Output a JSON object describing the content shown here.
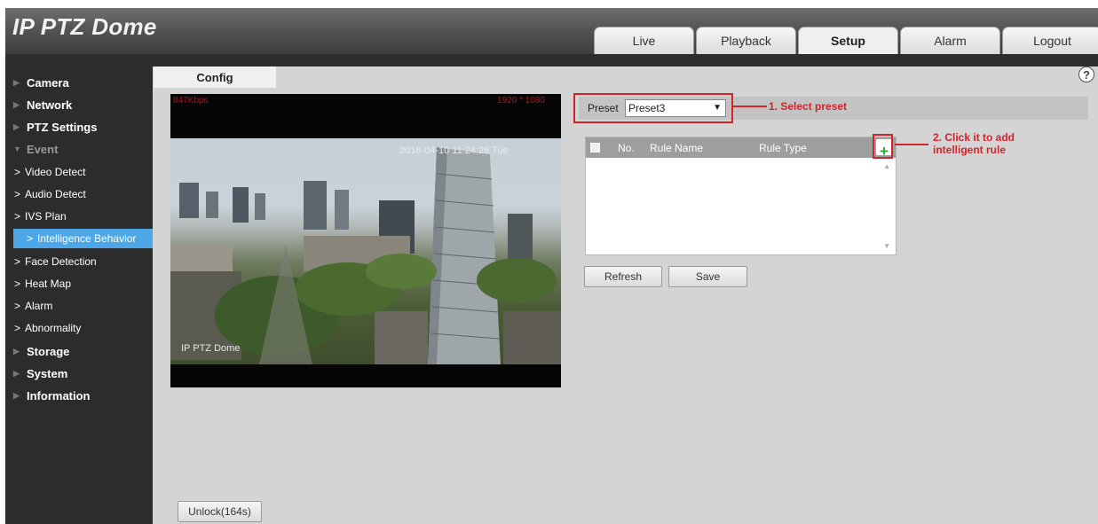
{
  "header": {
    "logo": "IP PTZ Dome",
    "tabs": [
      {
        "label": "Live",
        "active": false
      },
      {
        "label": "Playback",
        "active": false
      },
      {
        "label": "Setup",
        "active": true
      },
      {
        "label": "Alarm",
        "active": false
      },
      {
        "label": "Logout",
        "active": false
      }
    ]
  },
  "sidebar": {
    "items": [
      {
        "label": "Camera",
        "level": "top"
      },
      {
        "label": "Network",
        "level": "top"
      },
      {
        "label": "PTZ Settings",
        "level": "top"
      },
      {
        "label": "Event",
        "level": "top-expanded"
      },
      {
        "label": "Video Detect",
        "level": "sub"
      },
      {
        "label": "Audio Detect",
        "level": "sub"
      },
      {
        "label": "IVS Plan",
        "level": "sub"
      },
      {
        "label": "Intelligence Behavior",
        "level": "sub",
        "active": true
      },
      {
        "label": "Face Detection",
        "level": "sub"
      },
      {
        "label": "Heat Map",
        "level": "sub"
      },
      {
        "label": "Alarm",
        "level": "sub"
      },
      {
        "label": "Abnormality",
        "level": "sub"
      },
      {
        "label": "Storage",
        "level": "top"
      },
      {
        "label": "System",
        "level": "top"
      },
      {
        "label": "Information",
        "level": "top"
      }
    ]
  },
  "content": {
    "tab_label": "Config",
    "help_glyph": "?",
    "video": {
      "bitrate": "847Kbps",
      "resolution": "1920 * 1080",
      "timestamp": "2018-04-10 11:24:26 Tue",
      "camera_name": "IP PTZ Dome"
    },
    "preset": {
      "label": "Preset",
      "value": "Preset3"
    },
    "annotations": {
      "select_preset": "1. Select preset",
      "add_rule_line1": "2. Click it to add",
      "add_rule_line2": "intelligent rule"
    },
    "rule_table": {
      "columns": [
        "No.",
        "Rule Name",
        "Rule Type"
      ],
      "rows": []
    },
    "buttons": {
      "refresh": "Refresh",
      "save": "Save",
      "unlock": "Unlock(164s)"
    }
  },
  "colors": {
    "accent": "#4da7e6",
    "annotation_red": "#d2232a",
    "add_green": "#2aa535"
  }
}
